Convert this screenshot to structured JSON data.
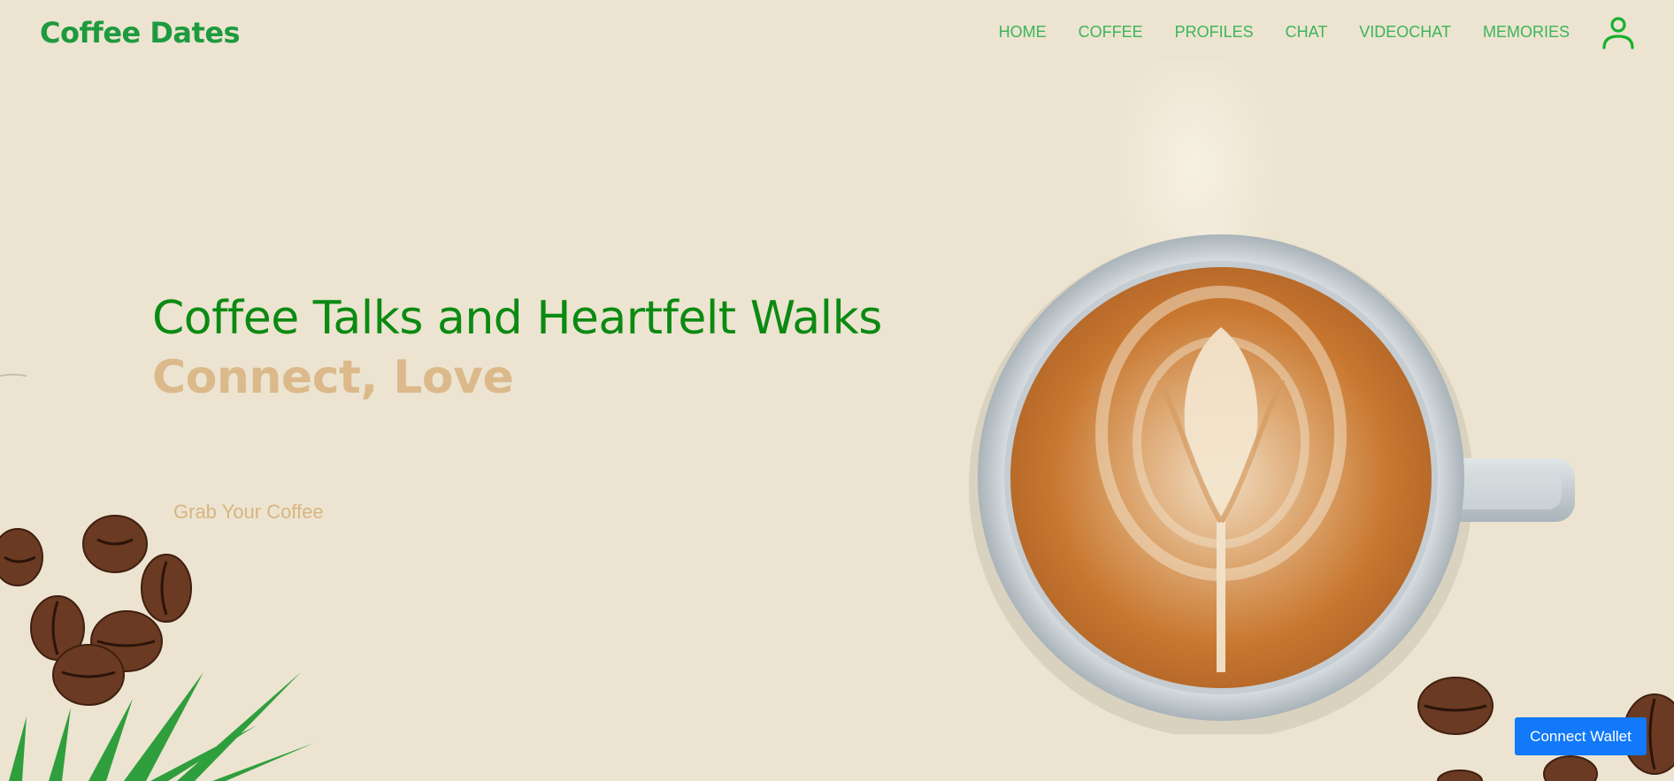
{
  "header": {
    "brand": "Coffee Dates",
    "nav": [
      "HOME",
      "COFFEE",
      "PROFILES",
      "CHAT",
      "VIDEOCHAT",
      "MEMORIES"
    ],
    "user_icon": "user-icon"
  },
  "hero": {
    "title": "Coffee Talks and Heartfelt Walks",
    "subtitle": "Connect, Love",
    "cta_label": "Grab Your Coffee"
  },
  "wallet": {
    "label": "Connect Wallet"
  },
  "colors": {
    "background": "#ece4d0",
    "brand": "#1e9a3e",
    "nav": "#3cb55a",
    "title": "#0b8a12",
    "subtitle": "#dcb98a",
    "wallet": "#1179fa"
  },
  "icons": [
    "user-icon",
    "coffee-cup-image",
    "coffee-bean-icon",
    "palm-leaf-image"
  ]
}
